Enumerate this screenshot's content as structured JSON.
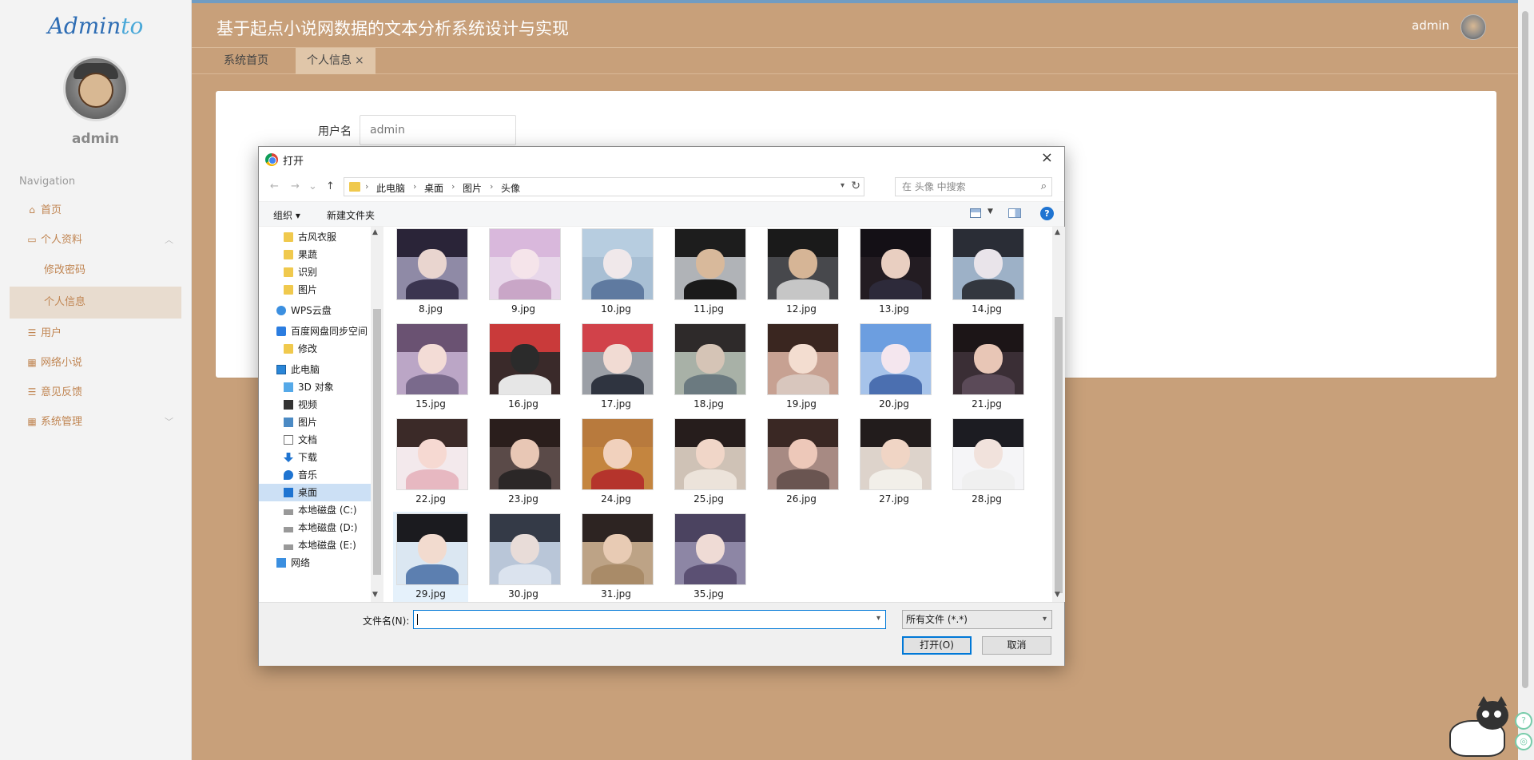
{
  "sidebar": {
    "logo": {
      "main": "Admin",
      "accent": "to"
    },
    "username": "admin",
    "nav_heading": "Navigation",
    "items": [
      {
        "label": "首页",
        "icon": "home-icon"
      },
      {
        "label": "个人资料",
        "icon": "profile-icon",
        "expanded": true,
        "children": [
          {
            "label": "修改密码"
          },
          {
            "label": "个人信息",
            "active": true
          }
        ]
      },
      {
        "label": "用户",
        "icon": "list-icon"
      },
      {
        "label": "网络小说",
        "icon": "grid-icon"
      },
      {
        "label": "意见反馈",
        "icon": "list-icon"
      },
      {
        "label": "系统管理",
        "icon": "grid-icon",
        "expanded": false
      }
    ]
  },
  "header": {
    "title": "基于起点小说网数据的文本分析系统设计与实现",
    "user": "admin"
  },
  "tabs": [
    {
      "label": "系统首页",
      "active": false
    },
    {
      "label": "个人信息",
      "active": true,
      "close": "×"
    }
  ],
  "form": {
    "username_label": "用户名",
    "username_value": "admin"
  },
  "dialog": {
    "title": "打开",
    "close": "×",
    "path": [
      "此电脑",
      "桌面",
      "图片",
      "头像"
    ],
    "search_placeholder": "在 头像 中搜索",
    "commands": {
      "organize": "组织 ▾",
      "new_folder": "新建文件夹",
      "help": "?"
    },
    "tree": [
      {
        "label": "古风衣服",
        "icon": "folder",
        "indent": 1
      },
      {
        "label": "果蔬",
        "icon": "folder",
        "indent": 1
      },
      {
        "label": "识别",
        "icon": "folder",
        "indent": 1
      },
      {
        "label": "图片",
        "icon": "folder",
        "indent": 1
      },
      {
        "label": "WPS云盘",
        "icon": "cloud",
        "indent": 0
      },
      {
        "label": "百度网盘同步空间",
        "icon": "baidu",
        "indent": 0
      },
      {
        "label": "修改",
        "icon": "folder",
        "indent": 1
      },
      {
        "label": "此电脑",
        "icon": "pc",
        "indent": 0
      },
      {
        "label": "3D 对象",
        "icon": "cube",
        "indent": 1
      },
      {
        "label": "视频",
        "icon": "video",
        "indent": 1
      },
      {
        "label": "图片",
        "icon": "pic",
        "indent": 1
      },
      {
        "label": "文档",
        "icon": "doc",
        "indent": 1
      },
      {
        "label": "下载",
        "icon": "dl",
        "indent": 1
      },
      {
        "label": "音乐",
        "icon": "music",
        "indent": 1
      },
      {
        "label": "桌面",
        "icon": "desktop",
        "indent": 1,
        "selected": true
      },
      {
        "label": "本地磁盘 (C:)",
        "icon": "disk",
        "indent": 1
      },
      {
        "label": "本地磁盘 (D:)",
        "icon": "disk",
        "indent": 1
      },
      {
        "label": "本地磁盘 (E:)",
        "icon": "disk",
        "indent": 1
      },
      {
        "label": "网络",
        "icon": "net",
        "indent": 0
      }
    ],
    "files": [
      {
        "name": "8.jpg",
        "hair": "#2a2438",
        "face": "#e9d5cf",
        "bg": "#8f8aa6",
        "cloth": "#3b3550"
      },
      {
        "name": "9.jpg",
        "hair": "#d9b8dc",
        "face": "#f5e4ea",
        "bg": "#e8d7ea",
        "cloth": "#c9a6c7"
      },
      {
        "name": "10.jpg",
        "hair": "#b7cde0",
        "face": "#f0e8ea",
        "bg": "#a8bfd4",
        "cloth": "#5f7aa0"
      },
      {
        "name": "11.jpg",
        "hair": "#1d1d1d",
        "face": "#d8b99b",
        "bg": "#b0b3b7",
        "cloth": "#1a1a1a"
      },
      {
        "name": "12.jpg",
        "hair": "#1a1a1a",
        "face": "#d6b596",
        "bg": "#47484c",
        "cloth": "#c6c6c6"
      },
      {
        "name": "13.jpg",
        "hair": "#141016",
        "face": "#e9cfc1",
        "bg": "#231c22",
        "cloth": "#2d2a3a"
      },
      {
        "name": "14.jpg",
        "hair": "#2a2d36",
        "face": "#e9e4ea",
        "bg": "#9db1c7",
        "cloth": "#33373f"
      },
      {
        "name": "15.jpg",
        "hair": "#6a5272",
        "face": "#f3dcd6",
        "bg": "#bba6c6",
        "cloth": "#7a6a8c"
      },
      {
        "name": "16.jpg",
        "hair": "#c93a3a",
        "face": "#2b2b2b",
        "bg": "#3a2a2a",
        "cloth": "#e6e6e6"
      },
      {
        "name": "17.jpg",
        "hair": "#d1424a",
        "face": "#f1dbd3",
        "bg": "#9b9fa6",
        "cloth": "#2f3440"
      },
      {
        "name": "18.jpg",
        "hair": "#2e2a2a",
        "face": "#d5c4b6",
        "bg": "#a8b1a7",
        "cloth": "#6b7a80"
      },
      {
        "name": "19.jpg",
        "hair": "#3a2620",
        "face": "#f3ddd0",
        "bg": "#c7a192",
        "cloth": "#d8c6bd"
      },
      {
        "name": "20.jpg",
        "hair": "#6c9ee0",
        "face": "#f4e6ee",
        "bg": "#a6c3ea",
        "cloth": "#4b6fb0"
      },
      {
        "name": "21.jpg",
        "hair": "#1c1517",
        "face": "#e8c6b6",
        "bg": "#3a2e35",
        "cloth": "#5b4a58"
      },
      {
        "name": "22.jpg",
        "hair": "#3b2a28",
        "face": "#f6d9d2",
        "bg": "#f3e9ec",
        "cloth": "#e7b8c1"
      },
      {
        "name": "23.jpg",
        "hair": "#2a1e1c",
        "face": "#e8c7b5",
        "bg": "#5a4a48",
        "cloth": "#2b2727"
      },
      {
        "name": "24.jpg",
        "hair": "#b87a3d",
        "face": "#f1d1bd",
        "bg": "#c4853f",
        "cloth": "#b5342c"
      },
      {
        "name": "25.jpg",
        "hair": "#261d1c",
        "face": "#f0d6c8",
        "bg": "#cfc2b6",
        "cloth": "#ece3da"
      },
      {
        "name": "26.jpg",
        "hair": "#3a2824",
        "face": "#edc8b9",
        "bg": "#a78a83",
        "cloth": "#6a5551"
      },
      {
        "name": "27.jpg",
        "hair": "#221c1c",
        "face": "#f0d5c5",
        "bg": "#ddd3cb",
        "cloth": "#f2efe9"
      },
      {
        "name": "28.jpg",
        "hair": "#1c1c22",
        "face": "#f1e2dc",
        "bg": "#f5f5f7",
        "cloth": "#f0f0f0"
      },
      {
        "name": "29.jpg",
        "hair": "#1b1b1f",
        "face": "#f2dbcf",
        "bg": "#dbe7f2",
        "cloth": "#5c7fb0",
        "hover": true
      },
      {
        "name": "30.jpg",
        "hair": "#343a47",
        "face": "#e8dcd8",
        "bg": "#b9c6d8",
        "cloth": "#dbe3ee"
      },
      {
        "name": "31.jpg",
        "hair": "#2d2422",
        "face": "#e8cbb4",
        "bg": "#bda386",
        "cloth": "#a98b68"
      },
      {
        "name": "35.jpg",
        "hair": "#4b4360",
        "face": "#efdbd5",
        "bg": "#8d86a5",
        "cloth": "#5b5073"
      }
    ],
    "filename_label": "文件名(N):",
    "filename_value": "",
    "filter": "所有文件 (*.*)",
    "open_button": "打开(O)",
    "cancel_button": "取消"
  }
}
